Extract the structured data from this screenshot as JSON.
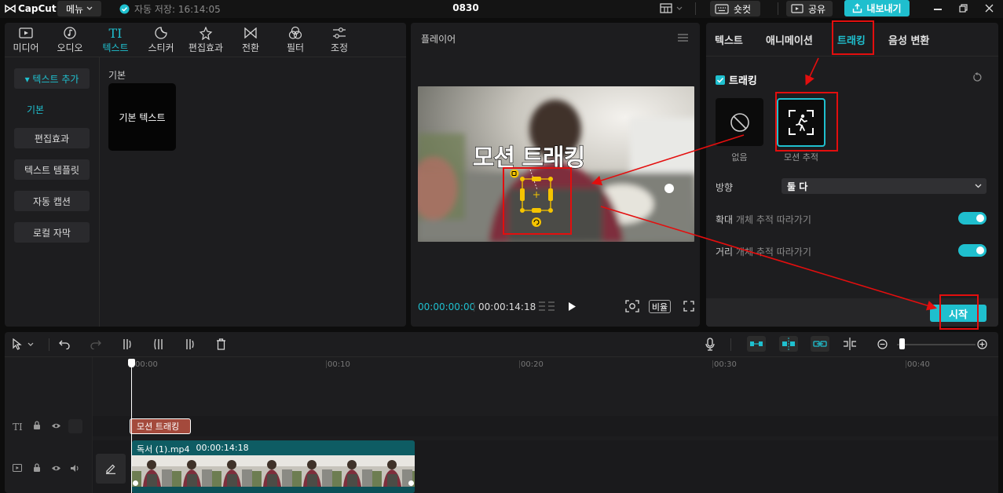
{
  "titlebar": {
    "logo_text": "CapCut",
    "menu_label": "메뉴",
    "autosave": "자동 저장: 16:14:05",
    "project_title": "0830",
    "shortcut_label": "숏컷",
    "share_label": "공유",
    "export_label": "내보내기"
  },
  "categories": [
    {
      "label": "미디어"
    },
    {
      "label": "오디오"
    },
    {
      "label": "텍스트",
      "icon_text": "TI"
    },
    {
      "label": "스티커"
    },
    {
      "label": "편집효과"
    },
    {
      "label": "전환"
    },
    {
      "label": "필터"
    },
    {
      "label": "조정"
    }
  ],
  "sidebar": {
    "add_text": "▾ 텍스트 추가",
    "basic": "기본",
    "effects": "편집효과",
    "templates": "텍스트 템플릿",
    "auto_caption": "자동 캡션",
    "local_caption": "로컬 자막"
  },
  "content": {
    "section_label": "기본",
    "preset_label": "기본 텍스트"
  },
  "player": {
    "title": "플레이어",
    "overlay_text": "모션 트래킹",
    "time_current": "00:00:00:00",
    "time_total": "00:00:14:18",
    "ratio_label": "비율"
  },
  "right_panel": {
    "tabs": [
      {
        "label": "텍스트"
      },
      {
        "label": "애니메이션"
      },
      {
        "label": "트래킹"
      },
      {
        "label": "음성 변환"
      }
    ],
    "tracking_label": "트래킹",
    "options": [
      {
        "label": "없음"
      },
      {
        "label": "모션 추적"
      }
    ],
    "direction_label": "방향",
    "direction_value": "둘 다",
    "scale_label": "확대",
    "scale_desc": "개체 추적 따라가기",
    "distance_label": "거리",
    "distance_desc": "개체 추적 따라가기",
    "start_label": "시작"
  },
  "timeline": {
    "ruler": [
      "00:00",
      "00:10",
      "00:20",
      "00:30",
      "00:40"
    ],
    "text_clip": "모션 트래킹",
    "video_clip_name": "독서 (1).mp4",
    "video_clip_duration": "00:00:14:18",
    "text_track_icon": "TI"
  },
  "colors": {
    "accent": "#1fc0cf",
    "annotation": "#e30e0e",
    "text_clip": "#a44a3c",
    "video_clip": "#0e5c63"
  }
}
